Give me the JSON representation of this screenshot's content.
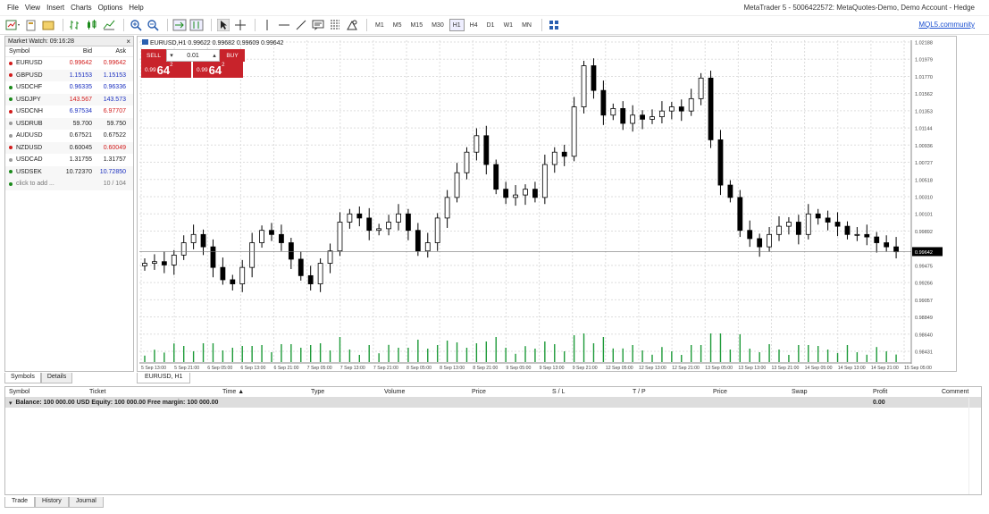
{
  "menu": {
    "items": [
      "File",
      "View",
      "Insert",
      "Charts",
      "Options",
      "Help"
    ],
    "title": "MetaTrader 5 - 5006422572: MetaQuotes-Demo, Demo Account - Hedge"
  },
  "toolbar": {
    "timeframes": [
      "M1",
      "M5",
      "M15",
      "M30",
      "H1",
      "H4",
      "D1",
      "W1",
      "MN"
    ],
    "active_tf": "H1",
    "mql_link": "MQL5.community"
  },
  "market_watch": {
    "title": "Market Watch: 09:16:28",
    "close": "×",
    "cols": [
      "Symbol",
      "Bid",
      "Ask"
    ],
    "rows": [
      {
        "symbol": "EURUSD",
        "bid": "0.99642",
        "ask": "0.99642",
        "color": "red",
        "dot": "#d21b1b"
      },
      {
        "symbol": "GBPUSD",
        "bid": "1.15153",
        "ask": "1.15153",
        "color": "blue",
        "dot": "#d21b1b"
      },
      {
        "symbol": "USDCHF",
        "bid": "0.96335",
        "ask": "0.96336",
        "color": "blue",
        "dot": "#1a8a1a"
      },
      {
        "symbol": "USDJPY",
        "bid": "143.567",
        "ask": "143.573",
        "color": "redblue",
        "dot": "#1a8a1a"
      },
      {
        "symbol": "USDCNH",
        "bid": "6.97534",
        "ask": "6.97707",
        "color": "bluered",
        "dot": "#d21b1b"
      },
      {
        "symbol": "USDRUB",
        "bid": "59.700",
        "ask": "59.750",
        "color": "blk",
        "dot": "#999"
      },
      {
        "symbol": "AUDUSD",
        "bid": "0.67521",
        "ask": "0.67522",
        "color": "blk",
        "dot": "#999"
      },
      {
        "symbol": "NZDUSD",
        "bid": "0.60045",
        "ask": "0.60049",
        "color": "blkred",
        "dot": "#d21b1b"
      },
      {
        "symbol": "USDCAD",
        "bid": "1.31755",
        "ask": "1.31757",
        "color": "blk",
        "dot": "#999"
      },
      {
        "symbol": "USDSEK",
        "bid": "10.72370",
        "ask": "10.72850",
        "color": "blkblue",
        "dot": "#1a8a1a"
      }
    ],
    "add_row": {
      "label": "click to add ...",
      "count": "10 / 104"
    },
    "tabs": [
      "Symbols",
      "Details"
    ]
  },
  "chart": {
    "label": "EURUSD,H1  0.99622 0.99682 0.99609 0.99642",
    "tab": "EURUSD, H1",
    "one_click": {
      "sell": "SELL",
      "buy": "BUY",
      "lot": "0.01",
      "sell_small": "0.99",
      "sell_big": "64",
      "sell_sup": "2",
      "buy_small": "0.99",
      "buy_big": "64",
      "buy_sup": "2"
    },
    "price_labels": [
      "1.02188",
      "1.01979",
      "1.01770",
      "1.01562",
      "1.01353",
      "1.01144",
      "1.00936",
      "1.00727",
      "1.00518",
      "1.00310",
      "1.00101",
      "0.99892",
      "0.99642",
      "0.99475",
      "0.99266",
      "0.99057",
      "0.98849",
      "0.98640",
      "0.98431"
    ],
    "current_price": "0.99642",
    "time_labels": [
      "5 Sep 13:00",
      "5 Sep 21:00",
      "6 Sep 05:00",
      "6 Sep 13:00",
      "6 Sep 21:00",
      "7 Sep 05:00",
      "7 Sep 13:00",
      "7 Sep 21:00",
      "8 Sep 05:00",
      "8 Sep 13:00",
      "8 Sep 21:00",
      "9 Sep 05:00",
      "9 Sep 13:00",
      "9 Sep 21:00",
      "12 Sep 05:00",
      "12 Sep 13:00",
      "12 Sep 21:00",
      "13 Sep 05:00",
      "13 Sep 13:00",
      "13 Sep 21:00",
      "14 Sep 05:00",
      "14 Sep 13:00",
      "14 Sep 21:00",
      "15 Sep 05:00"
    ]
  },
  "chart_data": {
    "type": "candlestick",
    "symbol": "EURUSD",
    "timeframe": "H1",
    "ylim": [
      0.98431,
      1.02188
    ],
    "close": [
      0.995,
      0.9952,
      0.9948,
      0.996,
      0.9975,
      0.9985,
      0.997,
      0.9945,
      0.993,
      0.9925,
      0.9945,
      0.9975,
      0.999,
      0.9985,
      0.9975,
      0.9955,
      0.9935,
      0.9925,
      0.995,
      0.9965,
      1.0,
      1.001,
      1.0005,
      0.999,
      0.9992,
      1.0,
      1.001,
      0.999,
      0.9965,
      0.9975,
      1.0005,
      1.003,
      1.006,
      1.0085,
      1.0105,
      1.007,
      1.004,
      1.003,
      1.0033,
      1.004,
      1.003,
      1.007,
      1.0085,
      1.008,
      1.014,
      1.019,
      1.016,
      1.013,
      1.0138,
      1.012,
      1.013,
      1.0125,
      1.0128,
      1.0135,
      1.014,
      1.0135,
      1.015,
      1.0175,
      1.01,
      1.0045,
      1.003,
      0.999,
      0.998,
      0.997,
      0.9985,
      0.9995,
      1.0,
      0.9985,
      1.001,
      1.0005,
      1.0,
      0.9995,
      0.9985,
      0.9985,
      0.9982,
      0.9975,
      0.997,
      0.9964
    ]
  },
  "trade": {
    "cols": [
      "Symbol",
      "Ticket",
      "Time ▲",
      "Type",
      "Volume",
      "Price",
      "S / L",
      "T / P",
      "Price",
      "Swap",
      "Profit",
      "Comment"
    ],
    "balance": "Balance: 100 000.00 USD  Equity: 100 000.00  Free margin: 100 000.00",
    "profit": "0.00",
    "tabs": [
      "Trade",
      "History",
      "Journal"
    ]
  },
  "colors": {
    "bull": "#ffffff",
    "bear": "#000000",
    "volume": "#1d9a38",
    "accent": "#c8232b"
  }
}
